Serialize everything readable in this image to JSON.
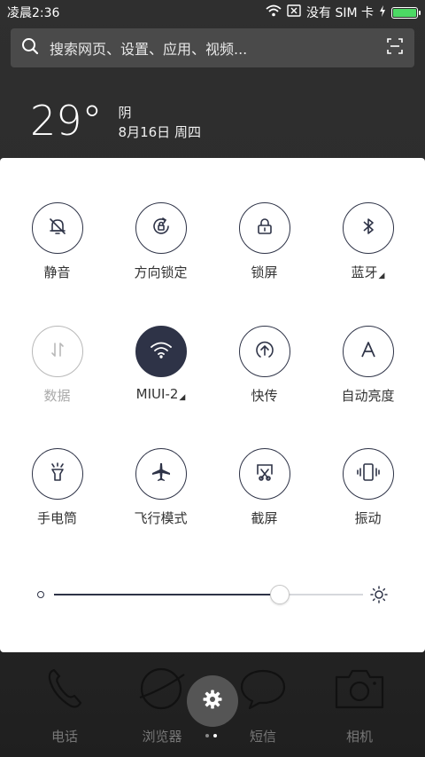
{
  "status_bar": {
    "time": "凌晨2:36",
    "no_sim": "没有 SIM 卡",
    "battery_level": 1.0
  },
  "search": {
    "placeholder": "搜索网页、设置、应用、视频..."
  },
  "weather": {
    "temperature": "29°",
    "condition": "阴",
    "date": "8月16日 周四"
  },
  "toggles": [
    {
      "label": "静音",
      "icon": "mute-bell-icon",
      "state": "off"
    },
    {
      "label": "方向锁定",
      "icon": "rotation-lock-icon",
      "state": "off"
    },
    {
      "label": "锁屏",
      "icon": "lock-icon",
      "state": "off"
    },
    {
      "label": "蓝牙",
      "icon": "bluetooth-icon",
      "state": "off",
      "has_more": true
    },
    {
      "label": "数据",
      "icon": "mobile-data-icon",
      "state": "disabled"
    },
    {
      "label": "MIUI-2",
      "icon": "wifi-icon",
      "state": "on",
      "has_more": true
    },
    {
      "label": "快传",
      "icon": "quick-transfer-icon",
      "state": "off"
    },
    {
      "label": "自动亮度",
      "icon": "auto-brightness-icon",
      "state": "off"
    },
    {
      "label": "手电筒",
      "icon": "flashlight-icon",
      "state": "off"
    },
    {
      "label": "飞行模式",
      "icon": "airplane-icon",
      "state": "off"
    },
    {
      "label": "截屏",
      "icon": "screenshot-icon",
      "state": "off"
    },
    {
      "label": "振动",
      "icon": "vibrate-icon",
      "state": "off"
    }
  ],
  "brightness": {
    "level": 0.73
  },
  "dock": [
    {
      "label": "电话",
      "icon": "phone-icon"
    },
    {
      "label": "浏览器",
      "icon": "browser-icon"
    },
    {
      "label": "短信",
      "icon": "message-icon"
    },
    {
      "label": "相机",
      "icon": "camera-icon"
    }
  ],
  "colors": {
    "accent": "#2e3347",
    "panel": "#ffffff",
    "disabled": "#b8b8b8",
    "battery": "#4cd964"
  }
}
